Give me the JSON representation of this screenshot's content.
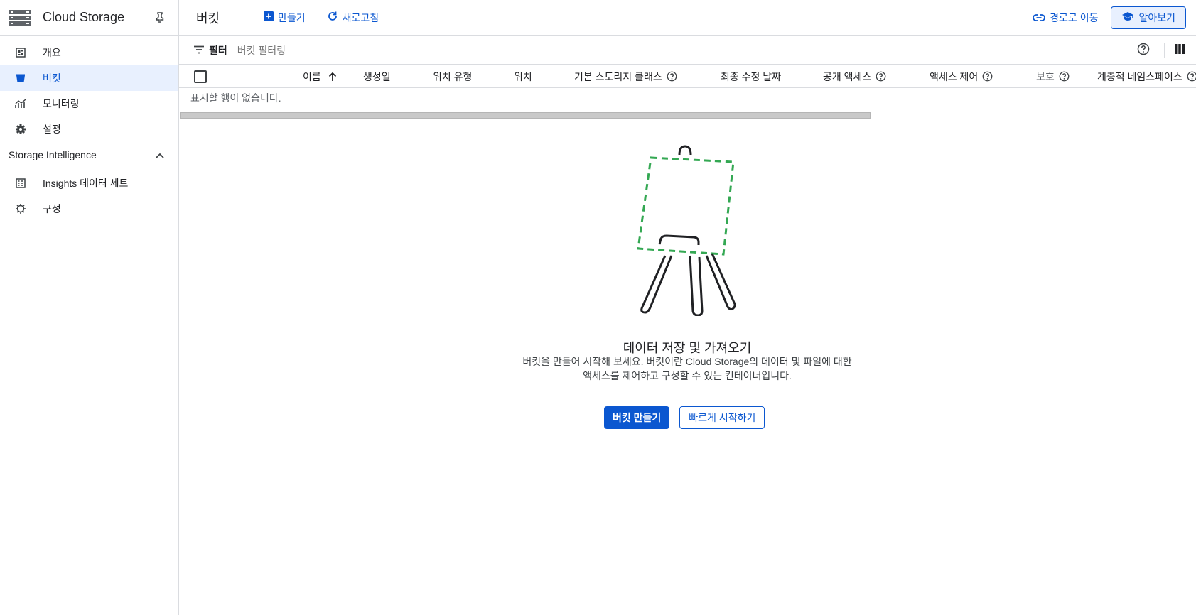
{
  "sidebar": {
    "product_name": "Cloud Storage",
    "items": [
      {
        "label": "개요",
        "icon": "dashboard-icon"
      },
      {
        "label": "버킷",
        "icon": "bucket-icon",
        "active": true
      },
      {
        "label": "모니터링",
        "icon": "monitoring-icon"
      },
      {
        "label": "설정",
        "icon": "gear-icon"
      }
    ],
    "section": {
      "title": "Storage Intelligence",
      "items": [
        {
          "label": "Insights 데이터 세트",
          "icon": "dataset-icon"
        },
        {
          "label": "구성",
          "icon": "config-icon"
        }
      ]
    }
  },
  "header": {
    "title": "버킷",
    "create_label": "만들기",
    "refresh_label": "새로고침",
    "path_label": "경로로 이동",
    "learn_label": "알아보기"
  },
  "filter": {
    "label": "필터",
    "placeholder": "버킷 필터링"
  },
  "table": {
    "columns": [
      {
        "label": "이름",
        "sort": "ascending"
      },
      {
        "label": "생성일"
      },
      {
        "label": "위치 유형"
      },
      {
        "label": "위치"
      },
      {
        "label": "기본 스토리지 클래스",
        "help": true
      },
      {
        "label": "최종 수정 날짜"
      },
      {
        "label": "공개 액세스",
        "help": true
      },
      {
        "label": "액세스 제어",
        "help": true
      },
      {
        "label": "보호",
        "help": true
      },
      {
        "label": "계층적 네임스페이스",
        "help": true
      }
    ],
    "empty_text": "표시할 행이 없습니다."
  },
  "empty_state": {
    "title": "데이터 저장 및 가져오기",
    "desc_line1": "버킷을 만들어 시작해 보세요. 버킷이란 Cloud Storage의 데이터 및 파일에 대한",
    "desc_line2": "액세스를 제어하고 구성할 수 있는 컨테이너입니다.",
    "primary_button": "버킷 만들기",
    "secondary_button": "빠르게 시작하기"
  },
  "colors": {
    "accent": "#0b57d0",
    "active_bg": "#e8f0fe",
    "illustration_green": "#34a853"
  }
}
